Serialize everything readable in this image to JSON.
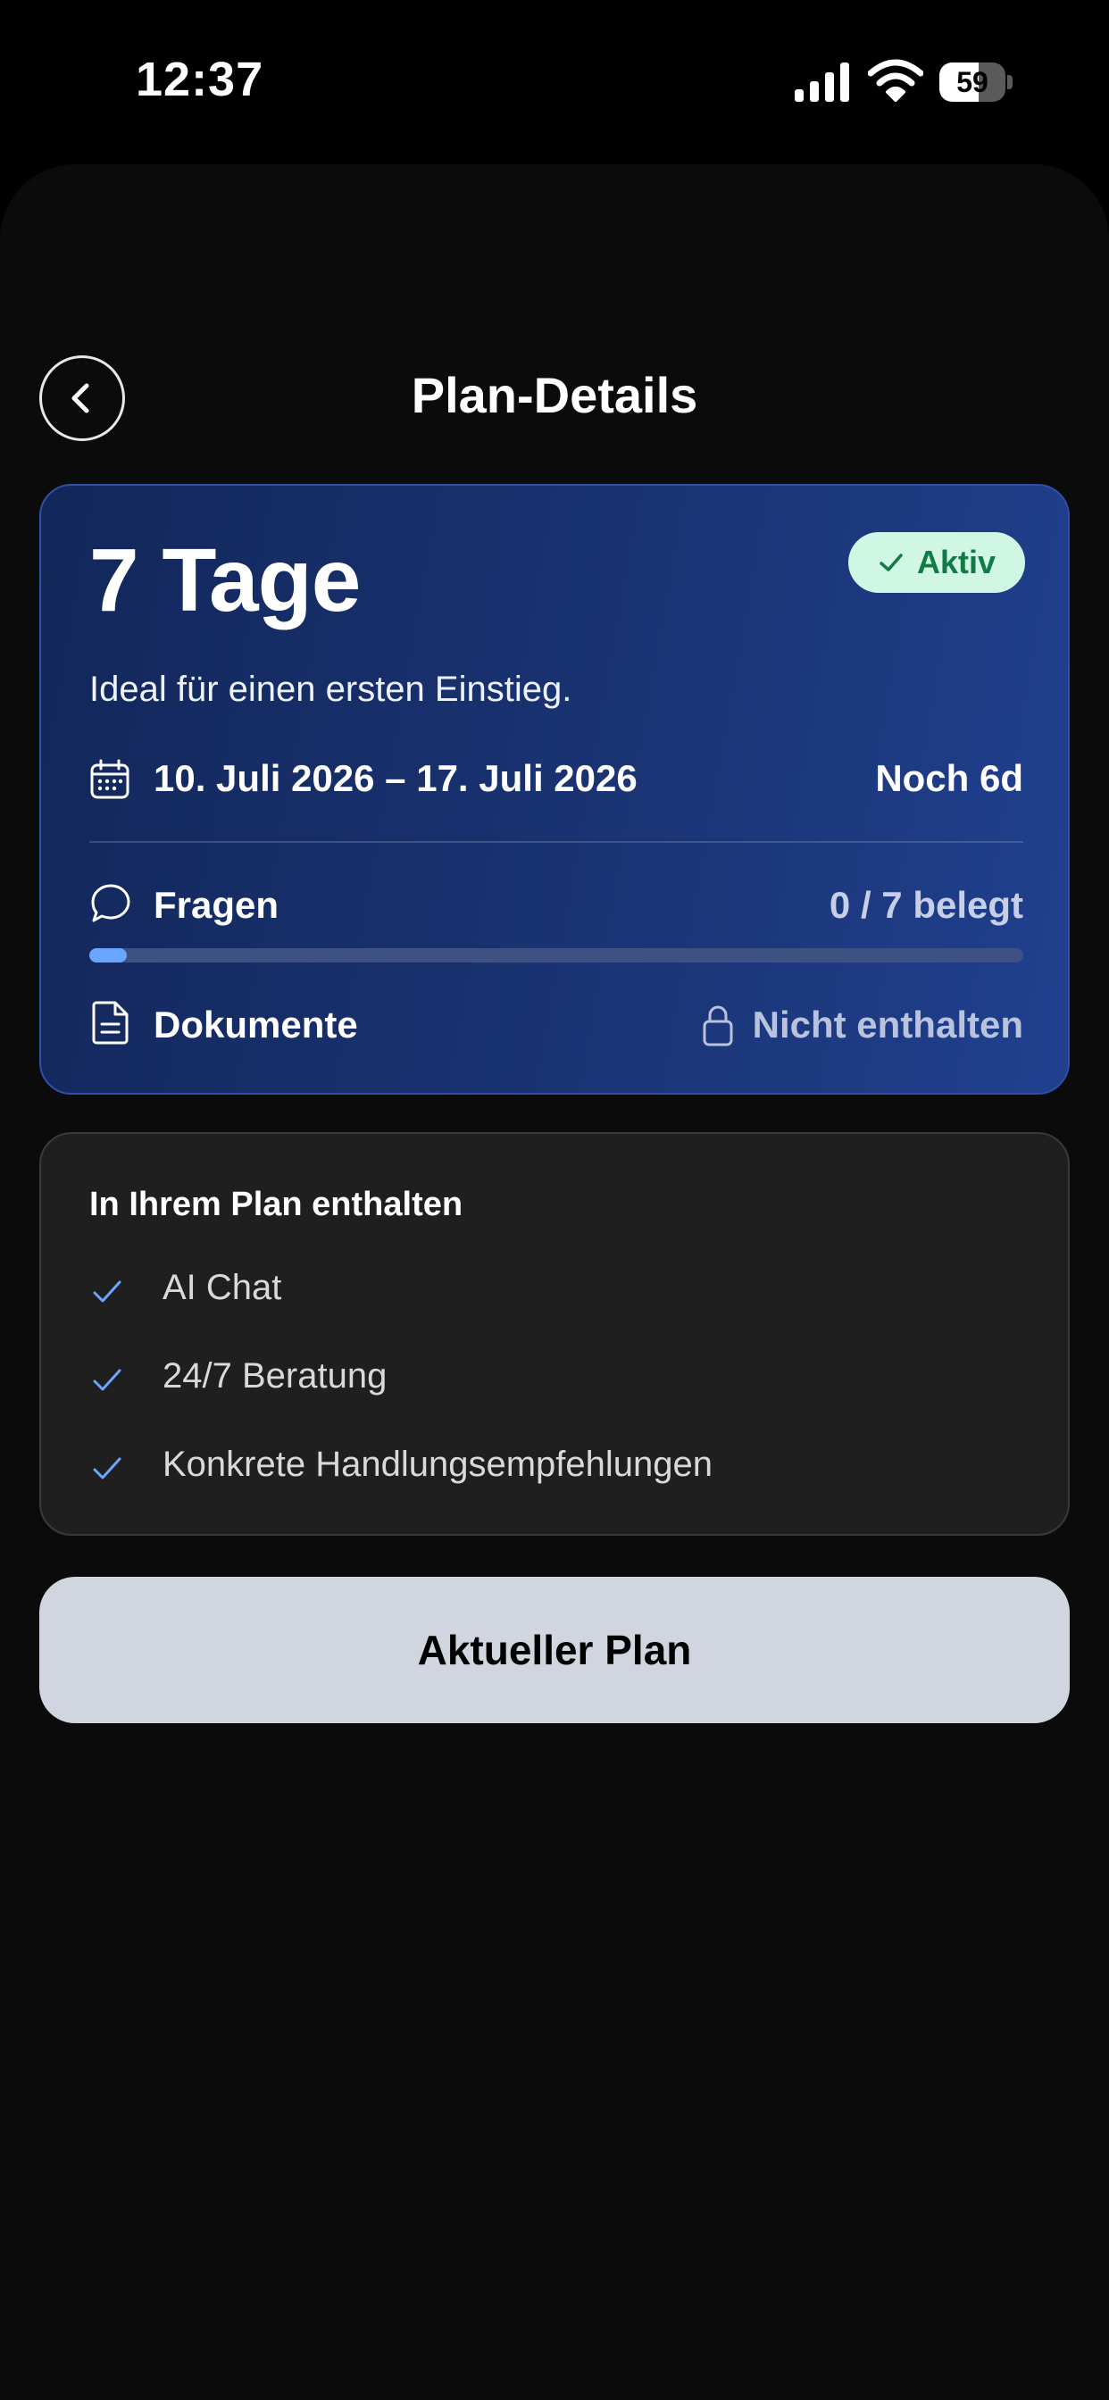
{
  "status_bar": {
    "time": "12:37",
    "battery_level": "59",
    "battery_fraction": 0.59
  },
  "header": {
    "title": "Plan-Details"
  },
  "plan": {
    "name": "7 Tage",
    "status_badge": "Aktiv",
    "description": "Ideal für einen ersten Einstieg.",
    "date_range": "10. Juli 2026 – 17. Juli 2026",
    "remaining": "Noch 6d",
    "questions_label": "Fragen",
    "questions_usage": "0 / 7 belegt",
    "questions_progress": 0.04,
    "documents_label": "Dokumente",
    "documents_status": "Nicht enthalten"
  },
  "features": {
    "title": "In Ihrem Plan enthalten",
    "items": [
      {
        "label": "AI Chat"
      },
      {
        "label": "24/7 Beratung"
      },
      {
        "label": "Konkrete Handlungsempfehlungen"
      }
    ]
  },
  "actions": {
    "current_plan_label": "Aktueller Plan"
  },
  "colors": {
    "accent": "#6aa6ff",
    "badge_bg": "#cff7e4",
    "badge_text": "#117a47",
    "card_bg": "#1a3373"
  },
  "icons": [
    "signal-icon",
    "wifi-icon",
    "battery-icon",
    "chevron-left-icon",
    "check-icon",
    "calendar-icon",
    "chat-bubble-icon",
    "document-icon",
    "lock-icon"
  ]
}
